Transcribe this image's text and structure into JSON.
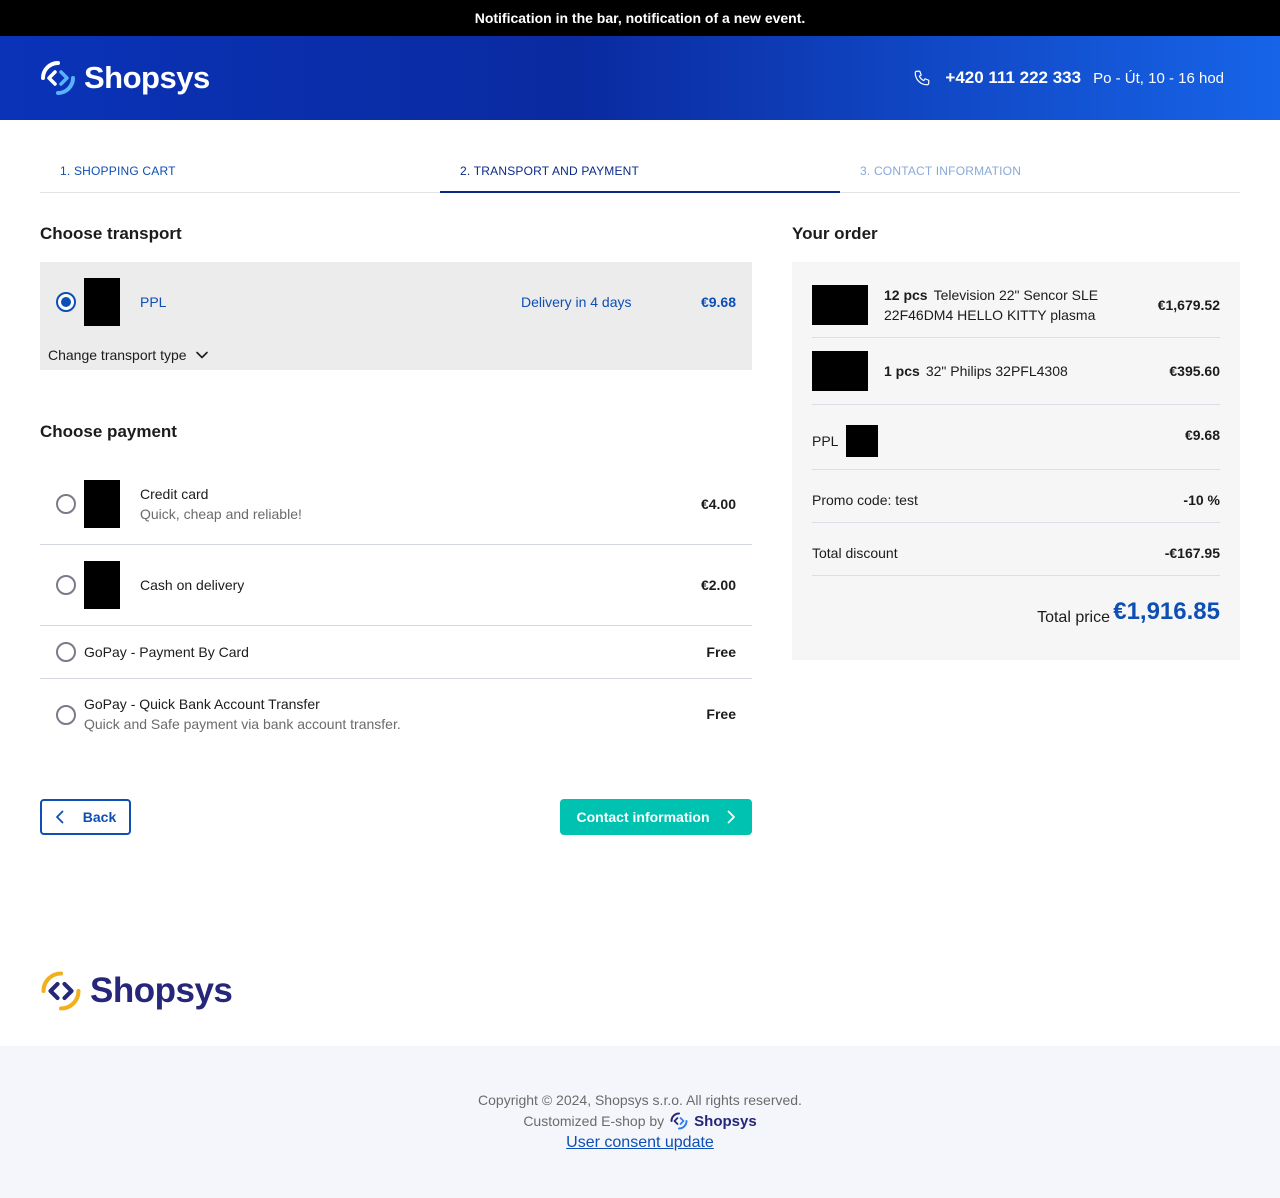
{
  "notification": "Notification in the bar, notification of a new event.",
  "header": {
    "logo_text": "Shopsys",
    "phone": "+420 111 222 333",
    "hours": "Po - Út, 10 - 16 hod"
  },
  "steps": [
    {
      "label": "1. SHOPPING CART"
    },
    {
      "label": "2. TRANSPORT AND PAYMENT"
    },
    {
      "label": "3. CONTACT INFORMATION"
    }
  ],
  "transport": {
    "title": "Choose transport",
    "option": {
      "name": "PPL",
      "delivery": "Delivery in 4 days",
      "price": "€9.68",
      "selected": true
    },
    "change_label": "Change transport type"
  },
  "payment": {
    "title": "Choose payment",
    "options": [
      {
        "name": "Credit card",
        "description": "Quick, cheap and reliable!",
        "price": "€4.00"
      },
      {
        "name": "Cash on delivery",
        "price": "€2.00"
      },
      {
        "name": "GoPay - Payment By Card",
        "price": "Free"
      },
      {
        "name": "GoPay - Quick Bank Account Transfer",
        "description": "Quick and Safe payment via bank account transfer.",
        "price": "Free"
      }
    ]
  },
  "buttons": {
    "back": "Back",
    "next": "Contact information"
  },
  "order": {
    "title": "Your order",
    "items": [
      {
        "qty": "12 pcs",
        "name_line1": "Television 22\" Sencor SLE",
        "name_line2": "22F46DM4 HELLO KITTY plasma",
        "price": "€1,679.52"
      },
      {
        "qty": "1 pcs",
        "name_line1": "32\" Philips 32PFL4308",
        "price": "€395.60"
      }
    ],
    "transport": {
      "name": "PPL",
      "price": "€9.68"
    },
    "promo": {
      "label": "Promo code: test",
      "value": "-10 %"
    },
    "discount": {
      "label": "Total discount",
      "value": "-€167.95"
    },
    "total": {
      "label": "Total price",
      "value": "€1,916.85"
    }
  },
  "footer": {
    "logo_text": "Shopsys",
    "copyright": "Copyright © 2024, Shopsys s.r.o. All rights reserved.",
    "customized": "Customized E-shop by",
    "mini_logo_text": "Shopsys",
    "consent": "User consent update"
  }
}
